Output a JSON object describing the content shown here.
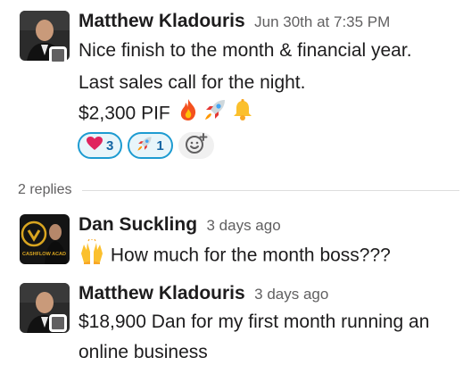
{
  "messages": [
    {
      "author": "Matthew Kladouris",
      "time": "Jun 30th at 7:35 PM",
      "lines": [
        "Nice finish to the month & financial year.",
        "Last sales call for the night.",
        "$2,300 PIF"
      ],
      "inline_icons": [
        "fire-emoji",
        "rocket-emoji",
        "bell-emoji"
      ],
      "reactions": [
        {
          "emoji": "heart-emoji",
          "count": "3"
        },
        {
          "emoji": "rocket-emoji",
          "count": "1"
        }
      ],
      "add_reaction_icon": "add-reaction-icon"
    },
    {
      "author": "Dan Suckling",
      "time": "3 days ago",
      "lines": [
        "How much for the month boss???"
      ],
      "inline_icons": [
        "raised-hands-emoji"
      ],
      "avatar_logo_text": "CASHFLOW ACAD"
    },
    {
      "author": "Matthew Kladouris",
      "time": "3 days ago",
      "lines": [
        "$18,900 Dan for my first month running an",
        "online business"
      ]
    }
  ],
  "thread": {
    "replies_label": "2 replies"
  },
  "colors": {
    "reaction_border": "#1d9bd1",
    "reaction_bg": "#e8f5fa",
    "reaction_text": "#1264a3",
    "presence": "#616061"
  }
}
